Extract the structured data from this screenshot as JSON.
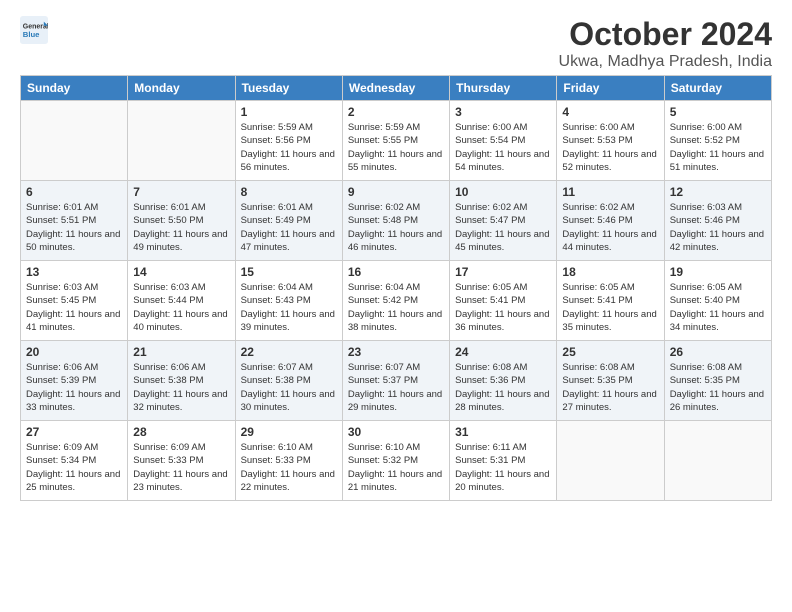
{
  "logo": {
    "text_general": "General",
    "text_blue": "Blue"
  },
  "title": "October 2024",
  "location": "Ukwa, Madhya Pradesh, India",
  "days_of_week": [
    "Sunday",
    "Monday",
    "Tuesday",
    "Wednesday",
    "Thursday",
    "Friday",
    "Saturday"
  ],
  "weeks": [
    [
      {
        "day": "",
        "info": ""
      },
      {
        "day": "",
        "info": ""
      },
      {
        "day": "1",
        "info": "Sunrise: 5:59 AM\nSunset: 5:56 PM\nDaylight: 11 hours and 56 minutes."
      },
      {
        "day": "2",
        "info": "Sunrise: 5:59 AM\nSunset: 5:55 PM\nDaylight: 11 hours and 55 minutes."
      },
      {
        "day": "3",
        "info": "Sunrise: 6:00 AM\nSunset: 5:54 PM\nDaylight: 11 hours and 54 minutes."
      },
      {
        "day": "4",
        "info": "Sunrise: 6:00 AM\nSunset: 5:53 PM\nDaylight: 11 hours and 52 minutes."
      },
      {
        "day": "5",
        "info": "Sunrise: 6:00 AM\nSunset: 5:52 PM\nDaylight: 11 hours and 51 minutes."
      }
    ],
    [
      {
        "day": "6",
        "info": "Sunrise: 6:01 AM\nSunset: 5:51 PM\nDaylight: 11 hours and 50 minutes."
      },
      {
        "day": "7",
        "info": "Sunrise: 6:01 AM\nSunset: 5:50 PM\nDaylight: 11 hours and 49 minutes."
      },
      {
        "day": "8",
        "info": "Sunrise: 6:01 AM\nSunset: 5:49 PM\nDaylight: 11 hours and 47 minutes."
      },
      {
        "day": "9",
        "info": "Sunrise: 6:02 AM\nSunset: 5:48 PM\nDaylight: 11 hours and 46 minutes."
      },
      {
        "day": "10",
        "info": "Sunrise: 6:02 AM\nSunset: 5:47 PM\nDaylight: 11 hours and 45 minutes."
      },
      {
        "day": "11",
        "info": "Sunrise: 6:02 AM\nSunset: 5:46 PM\nDaylight: 11 hours and 44 minutes."
      },
      {
        "day": "12",
        "info": "Sunrise: 6:03 AM\nSunset: 5:46 PM\nDaylight: 11 hours and 42 minutes."
      }
    ],
    [
      {
        "day": "13",
        "info": "Sunrise: 6:03 AM\nSunset: 5:45 PM\nDaylight: 11 hours and 41 minutes."
      },
      {
        "day": "14",
        "info": "Sunrise: 6:03 AM\nSunset: 5:44 PM\nDaylight: 11 hours and 40 minutes."
      },
      {
        "day": "15",
        "info": "Sunrise: 6:04 AM\nSunset: 5:43 PM\nDaylight: 11 hours and 39 minutes."
      },
      {
        "day": "16",
        "info": "Sunrise: 6:04 AM\nSunset: 5:42 PM\nDaylight: 11 hours and 38 minutes."
      },
      {
        "day": "17",
        "info": "Sunrise: 6:05 AM\nSunset: 5:41 PM\nDaylight: 11 hours and 36 minutes."
      },
      {
        "day": "18",
        "info": "Sunrise: 6:05 AM\nSunset: 5:41 PM\nDaylight: 11 hours and 35 minutes."
      },
      {
        "day": "19",
        "info": "Sunrise: 6:05 AM\nSunset: 5:40 PM\nDaylight: 11 hours and 34 minutes."
      }
    ],
    [
      {
        "day": "20",
        "info": "Sunrise: 6:06 AM\nSunset: 5:39 PM\nDaylight: 11 hours and 33 minutes."
      },
      {
        "day": "21",
        "info": "Sunrise: 6:06 AM\nSunset: 5:38 PM\nDaylight: 11 hours and 32 minutes."
      },
      {
        "day": "22",
        "info": "Sunrise: 6:07 AM\nSunset: 5:38 PM\nDaylight: 11 hours and 30 minutes."
      },
      {
        "day": "23",
        "info": "Sunrise: 6:07 AM\nSunset: 5:37 PM\nDaylight: 11 hours and 29 minutes."
      },
      {
        "day": "24",
        "info": "Sunrise: 6:08 AM\nSunset: 5:36 PM\nDaylight: 11 hours and 28 minutes."
      },
      {
        "day": "25",
        "info": "Sunrise: 6:08 AM\nSunset: 5:35 PM\nDaylight: 11 hours and 27 minutes."
      },
      {
        "day": "26",
        "info": "Sunrise: 6:08 AM\nSunset: 5:35 PM\nDaylight: 11 hours and 26 minutes."
      }
    ],
    [
      {
        "day": "27",
        "info": "Sunrise: 6:09 AM\nSunset: 5:34 PM\nDaylight: 11 hours and 25 minutes."
      },
      {
        "day": "28",
        "info": "Sunrise: 6:09 AM\nSunset: 5:33 PM\nDaylight: 11 hours and 23 minutes."
      },
      {
        "day": "29",
        "info": "Sunrise: 6:10 AM\nSunset: 5:33 PM\nDaylight: 11 hours and 22 minutes."
      },
      {
        "day": "30",
        "info": "Sunrise: 6:10 AM\nSunset: 5:32 PM\nDaylight: 11 hours and 21 minutes."
      },
      {
        "day": "31",
        "info": "Sunrise: 6:11 AM\nSunset: 5:31 PM\nDaylight: 11 hours and 20 minutes."
      },
      {
        "day": "",
        "info": ""
      },
      {
        "day": "",
        "info": ""
      }
    ]
  ]
}
